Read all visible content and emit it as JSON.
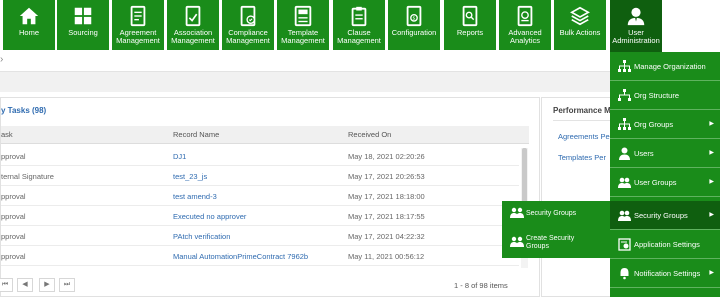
{
  "nav": [
    {
      "label": "Home",
      "icon": "home-icon"
    },
    {
      "label": "Sourcing",
      "icon": "grid-icon"
    },
    {
      "label": "Agreement Management",
      "icon": "agreement-icon"
    },
    {
      "label": "Association Management",
      "icon": "association-icon"
    },
    {
      "label": "Compliance Management",
      "icon": "compliance-icon"
    },
    {
      "label": "Template Management",
      "icon": "template-icon"
    },
    {
      "label": "Clause Management",
      "icon": "clause-icon"
    },
    {
      "label": "Configuration",
      "icon": "configuration-icon"
    },
    {
      "label": "Reports",
      "icon": "reports-icon"
    },
    {
      "label": "Advanced Analytics",
      "icon": "analytics-icon"
    },
    {
      "label": "Bulk Actions",
      "icon": "layers-icon"
    },
    {
      "label": "User Administration",
      "icon": "user-admin-icon"
    }
  ],
  "tasks": {
    "title": "y Tasks (98)",
    "columns": [
      "ask",
      "Record Name",
      "Received On"
    ],
    "rows": [
      {
        "task": "pproval",
        "record": "DJ1",
        "received": "May 18, 2021 02:20:26"
      },
      {
        "task": "ternal Signature",
        "record": "test_23_js",
        "received": "May 17, 2021 20:26:53"
      },
      {
        "task": "pproval",
        "record": "test amend-3",
        "received": "May 17, 2021 18:18:00"
      },
      {
        "task": "pproval",
        "record": "Executed no approver",
        "received": "May 17, 2021 18:17:55"
      },
      {
        "task": "pproval",
        "record": "PAtch verification",
        "received": "May 17, 2021 04:22:32"
      },
      {
        "task": "pproval",
        "record": "Manual AutomationPrimeContract 7962b",
        "received": "May 11, 2021 00:56:12"
      }
    ],
    "pager": {
      "first": "⏮",
      "prev": "◀",
      "next": "▶",
      "last": "⏭",
      "count": "1 - 8 of 98 items"
    }
  },
  "performance": {
    "title": "Performance Me",
    "links": [
      "Agreements Pe",
      "Templates Per"
    ]
  },
  "menu": [
    {
      "label": "Manage Organization",
      "icon": "manage-organization-icon",
      "has_submenu": false
    },
    {
      "label": "Org Structure",
      "icon": "org-structure-icon",
      "has_submenu": false
    },
    {
      "label": "Org Groups",
      "icon": "org-groups-icon",
      "has_submenu": true
    },
    {
      "label": "Users",
      "icon": "users-icon",
      "has_submenu": true
    },
    {
      "label": "User Groups",
      "icon": "user-groups-icon",
      "has_submenu": true
    },
    {
      "label": "Security Groups",
      "icon": "security-groups-icon",
      "has_submenu": true
    },
    {
      "label": "Application Settings",
      "icon": "application-settings-icon",
      "has_submenu": false
    },
    {
      "label": "Notification Settings",
      "icon": "notification-settings-icon",
      "has_submenu": true
    }
  ],
  "submenu": [
    {
      "label": "Security Groups",
      "icon": "security-groups-icon"
    },
    {
      "label": "Create Security\nGroups",
      "icon": "create-security-groups-icon"
    }
  ],
  "colors": {
    "brand": "#1a8c1a",
    "brand_dark": "#0f5f0f",
    "link": "#2f6bb0"
  }
}
